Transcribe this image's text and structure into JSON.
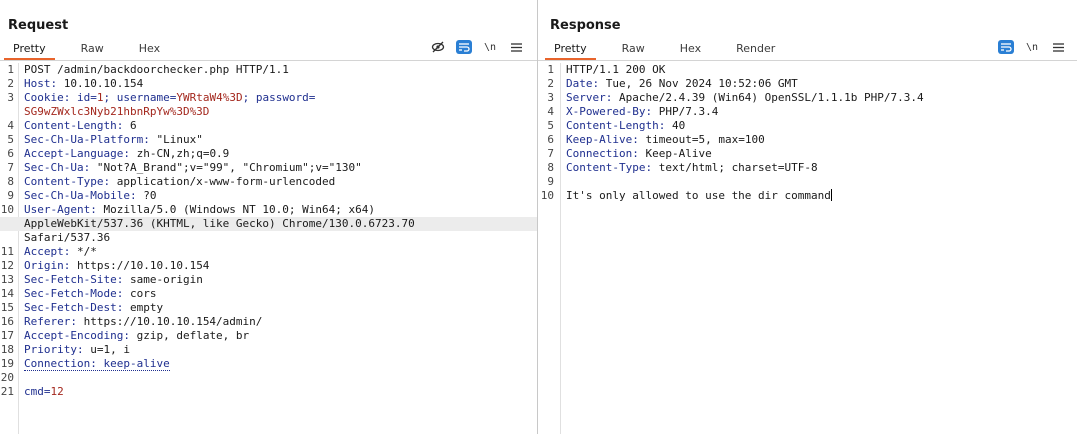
{
  "request": {
    "title": "Request",
    "tabs": [
      "Pretty",
      "Raw",
      "Hex"
    ],
    "active_tab": "Pretty",
    "toolbar": {
      "newline_label": "\\n"
    },
    "lines": [
      {
        "n": "1",
        "segments": [
          {
            "t": "POST /admin/backdoorchecker.php HTTP/1.1",
            "c": "val"
          }
        ]
      },
      {
        "n": "2",
        "segments": [
          {
            "t": "Host:",
            "c": "hk"
          },
          {
            "t": " 10.10.10.154",
            "c": "val"
          }
        ]
      },
      {
        "n": "3",
        "segments": [
          {
            "t": "Cookie:",
            "c": "hk"
          },
          {
            "t": " id=",
            "c": "pn"
          },
          {
            "t": "1",
            "c": "pv"
          },
          {
            "t": "; username=",
            "c": "pn"
          },
          {
            "t": "YWRtaW4%3D",
            "c": "pv"
          },
          {
            "t": "; password=",
            "c": "pn"
          }
        ]
      },
      {
        "n": "",
        "segments": [
          {
            "t": "SG9wZWxlc3Nyb21hbnRpYw%3D%3D",
            "c": "pv"
          }
        ]
      },
      {
        "n": "4",
        "segments": [
          {
            "t": "Content-Length:",
            "c": "hk"
          },
          {
            "t": " 6",
            "c": "val"
          }
        ]
      },
      {
        "n": "5",
        "segments": [
          {
            "t": "Sec-Ch-Ua-Platform:",
            "c": "hk"
          },
          {
            "t": " \"Linux\"",
            "c": "val"
          }
        ]
      },
      {
        "n": "6",
        "segments": [
          {
            "t": "Accept-Language:",
            "c": "hk"
          },
          {
            "t": " zh-CN,zh;q=0.9",
            "c": "val"
          }
        ]
      },
      {
        "n": "7",
        "segments": [
          {
            "t": "Sec-Ch-Ua:",
            "c": "hk"
          },
          {
            "t": " \"Not?A_Brand\";v=\"99\", \"Chromium\";v=\"130\"",
            "c": "val"
          }
        ]
      },
      {
        "n": "8",
        "segments": [
          {
            "t": "Content-Type:",
            "c": "hk"
          },
          {
            "t": " application/x-www-form-urlencoded",
            "c": "val"
          }
        ]
      },
      {
        "n": "9",
        "segments": [
          {
            "t": "Sec-Ch-Ua-Mobile:",
            "c": "hk"
          },
          {
            "t": " ?0",
            "c": "val"
          }
        ]
      },
      {
        "n": "10",
        "segments": [
          {
            "t": "User-Agent:",
            "c": "hk"
          },
          {
            "t": " Mozilla/5.0 (Windows NT 10.0; Win64; x64)",
            "c": "val"
          }
        ]
      },
      {
        "n": "",
        "hl": true,
        "segments": [
          {
            "t": "AppleWebKit/537.36 (KHTML, like Gecko) Chrome/130.0.6723.70",
            "c": "val"
          }
        ]
      },
      {
        "n": "",
        "segments": [
          {
            "t": "Safari/537.36",
            "c": "val"
          }
        ]
      },
      {
        "n": "11",
        "segments": [
          {
            "t": "Accept:",
            "c": "hk"
          },
          {
            "t": " */*",
            "c": "val"
          }
        ]
      },
      {
        "n": "12",
        "segments": [
          {
            "t": "Origin:",
            "c": "hk"
          },
          {
            "t": " https://10.10.10.154",
            "c": "val"
          }
        ]
      },
      {
        "n": "13",
        "segments": [
          {
            "t": "Sec-Fetch-Site:",
            "c": "hk"
          },
          {
            "t": " same-origin",
            "c": "val"
          }
        ]
      },
      {
        "n": "14",
        "segments": [
          {
            "t": "Sec-Fetch-Mode:",
            "c": "hk"
          },
          {
            "t": " cors",
            "c": "val"
          }
        ]
      },
      {
        "n": "15",
        "segments": [
          {
            "t": "Sec-Fetch-Dest:",
            "c": "hk"
          },
          {
            "t": " empty",
            "c": "val"
          }
        ]
      },
      {
        "n": "16",
        "segments": [
          {
            "t": "Referer:",
            "c": "hk"
          },
          {
            "t": " https://10.10.10.154/admin/",
            "c": "val"
          }
        ]
      },
      {
        "n": "17",
        "segments": [
          {
            "t": "Accept-Encoding:",
            "c": "hk"
          },
          {
            "t": " gzip, deflate, br",
            "c": "val"
          }
        ]
      },
      {
        "n": "18",
        "segments": [
          {
            "t": "Priority:",
            "c": "hk"
          },
          {
            "t": " u=1, i",
            "c": "val"
          }
        ]
      },
      {
        "n": "19",
        "segments": [
          {
            "t": "Connection: keep-alive",
            "c": "hk dotted"
          }
        ]
      },
      {
        "n": "20",
        "segments": []
      },
      {
        "n": "21",
        "segments": [
          {
            "t": "cmd=",
            "c": "pn"
          },
          {
            "t": "12",
            "c": "pv"
          }
        ]
      }
    ]
  },
  "response": {
    "title": "Response",
    "tabs": [
      "Pretty",
      "Raw",
      "Hex",
      "Render"
    ],
    "active_tab": "Pretty",
    "toolbar": {
      "newline_label": "\\n"
    },
    "lines": [
      {
        "n": "1",
        "segments": [
          {
            "t": "HTTP/1.1 200 OK",
            "c": "val"
          }
        ]
      },
      {
        "n": "2",
        "segments": [
          {
            "t": "Date:",
            "c": "hk"
          },
          {
            "t": " Tue, 26 Nov 2024 10:52:06 GMT",
            "c": "val"
          }
        ]
      },
      {
        "n": "3",
        "segments": [
          {
            "t": "Server:",
            "c": "hk"
          },
          {
            "t": " Apache/2.4.39 (Win64) OpenSSL/1.1.1b PHP/7.3.4",
            "c": "val"
          }
        ]
      },
      {
        "n": "4",
        "segments": [
          {
            "t": "X-Powered-By:",
            "c": "hk"
          },
          {
            "t": " PHP/7.3.4",
            "c": "val"
          }
        ]
      },
      {
        "n": "5",
        "segments": [
          {
            "t": "Content-Length:",
            "c": "hk"
          },
          {
            "t": " 40",
            "c": "val"
          }
        ]
      },
      {
        "n": "6",
        "segments": [
          {
            "t": "Keep-Alive:",
            "c": "hk"
          },
          {
            "t": " timeout=5, max=100",
            "c": "val"
          }
        ]
      },
      {
        "n": "7",
        "segments": [
          {
            "t": "Connection:",
            "c": "hk"
          },
          {
            "t": " Keep-Alive",
            "c": "val"
          }
        ]
      },
      {
        "n": "8",
        "segments": [
          {
            "t": "Content-Type:",
            "c": "hk"
          },
          {
            "t": " text/html; charset=UTF-8",
            "c": "val"
          }
        ]
      },
      {
        "n": "9",
        "segments": []
      },
      {
        "n": "10",
        "caret": true,
        "segments": [
          {
            "t": "It's only allowed to use the dir command",
            "c": "val"
          }
        ]
      }
    ]
  },
  "icons": {
    "hide": "eye-slash-icon",
    "wrap": "word-wrap-icon",
    "newline": "newline-icon",
    "menu": "menu-icon",
    "layout_side": "layout-side-by-side-icon",
    "layout_stack": "layout-stacked-icon",
    "layout_tabs": "layout-tabs-icon"
  },
  "colors": {
    "accent": "#e8642c",
    "header_name": "#1f2f8f",
    "param_value": "#a3271d",
    "toolbar_blue": "#2a7fd4"
  }
}
